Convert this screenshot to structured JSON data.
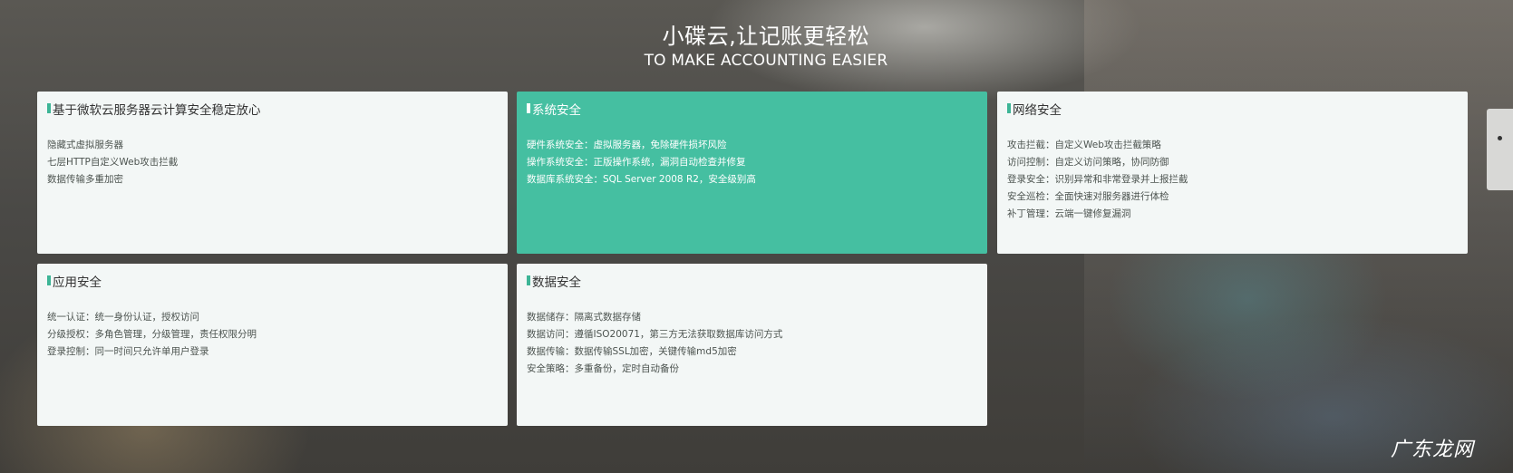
{
  "hero": {
    "title": "小碟云,让记账更轻松",
    "subtitle": "TO MAKE ACCOUNTING EASIER"
  },
  "cards": [
    {
      "title": "基于微软云服务器云计算安全稳定放心",
      "lines": [
        "隐藏式虚拟服务器",
        "七层HTTP自定义Web攻击拦截",
        "数据传输多重加密"
      ]
    },
    {
      "title": "系统安全",
      "lines": [
        "硬件系统安全：虚拟服务器，免除硬件损坏风险",
        "操作系统安全：正版操作系统，漏洞自动检查并修复",
        "数据库系统安全：SQL Server 2008 R2，安全级别高"
      ]
    },
    {
      "title": "网络安全",
      "lines": [
        "攻击拦截：自定义Web攻击拦截策略",
        "访问控制：自定义访问策略，协同防御",
        "登录安全：识别异常和非常登录并上报拦截",
        "安全巡检：全面快速对服务器进行体检",
        "补丁管理：云端一键修复漏洞"
      ]
    },
    {
      "title": "应用安全",
      "lines": [
        "统一认证：统一身份认证，授权访问",
        "分级授权：多角色管理，分级管理，责任权限分明",
        "登录控制：同一时间只允许单用户登录"
      ]
    },
    {
      "title": "数据安全",
      "lines": [
        "数据储存：隔离式数据存储",
        "数据访问：遵循ISO20071，第三方无法获取数据库访问方式",
        "数据传输：数据传输SSL加密，关键传输md5加密",
        "安全策略：多重备份，定时自动备份"
      ]
    }
  ],
  "watermark": "广东龙网",
  "colors": {
    "accent": "#45bfa1",
    "title_marker": "#3db596",
    "card_background": "#f3f7f6"
  }
}
